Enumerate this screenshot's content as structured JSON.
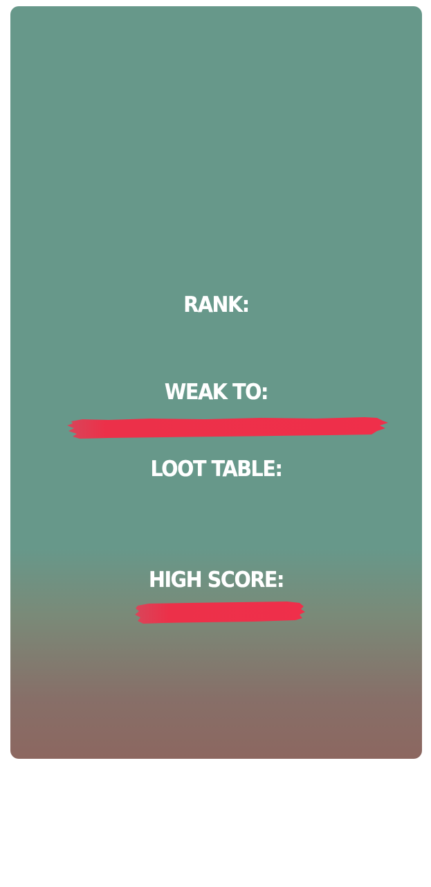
{
  "labels": {
    "rank": "RANK:",
    "weak_to": "WEAK TO:",
    "loot_table": "LOOT TABLE:",
    "high_score": "HIGH SCORE:"
  },
  "colors": {
    "card_top": "#67988a",
    "card_bottom": "#8c6760",
    "accent_stroke": "#ee2f4a",
    "text": "#ffffff"
  }
}
